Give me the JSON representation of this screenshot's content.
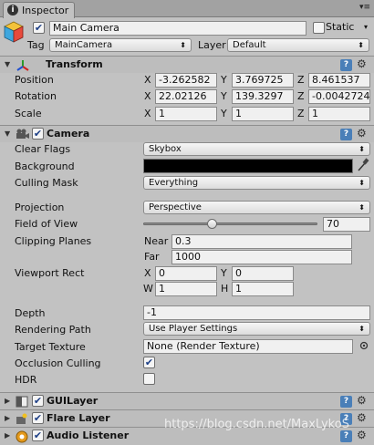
{
  "window": {
    "tab_label": "Inspector",
    "tab_icon": "info-icon",
    "menu_glyph": "▾≡"
  },
  "object": {
    "active": true,
    "name": "Main Camera",
    "static_label": "Static",
    "static_checked": false,
    "tag_label": "Tag",
    "tag_value": "MainCamera",
    "layer_label": "Layer",
    "layer_value": "Default"
  },
  "transform": {
    "title": "Transform",
    "position_label": "Position",
    "rotation_label": "Rotation",
    "scale_label": "Scale",
    "axes": {
      "x": "X",
      "y": "Y",
      "z": "Z"
    },
    "position": {
      "x": "-3.262582",
      "y": "3.769725",
      "z": "8.461537"
    },
    "rotation": {
      "x": "22.02126",
      "y": "139.3297",
      "z": "-0.0042724"
    },
    "scale": {
      "x": "1",
      "y": "1",
      "z": "1"
    }
  },
  "camera": {
    "title": "Camera",
    "enabled": true,
    "clear_flags_label": "Clear Flags",
    "clear_flags_value": "Skybox",
    "background_label": "Background",
    "background_color": "#000000",
    "culling_mask_label": "Culling Mask",
    "culling_mask_value": "Everything",
    "projection_label": "Projection",
    "projection_value": "Perspective",
    "fov_label": "Field of View",
    "fov_value": "70",
    "fov_fraction": 0.39,
    "clipping_label": "Clipping Planes",
    "near_label": "Near",
    "near_value": "0.3",
    "far_label": "Far",
    "far_value": "1000",
    "viewport_label": "Viewport Rect",
    "viewport": {
      "x_label": "X",
      "x": "0",
      "y_label": "Y",
      "y": "0",
      "w_label": "W",
      "w": "1",
      "h_label": "H",
      "h": "1"
    },
    "depth_label": "Depth",
    "depth_value": "-1",
    "rendering_path_label": "Rendering Path",
    "rendering_path_value": "Use Player Settings",
    "target_texture_label": "Target Texture",
    "target_texture_value": "None (Render Texture)",
    "occlusion_label": "Occlusion Culling",
    "occlusion_checked": true,
    "hdr_label": "HDR",
    "hdr_checked": false
  },
  "components": {
    "gui_layer": {
      "title": "GUILayer",
      "enabled": true
    },
    "flare_layer": {
      "title": "Flare Layer",
      "enabled": true
    },
    "audio_listener": {
      "title": "Audio Listener",
      "enabled": true
    }
  },
  "watermark": "https://blog.csdn.net/MaxLykoS",
  "colors": {
    "accent": "#4a7fb8",
    "panel": "#c2c2c2",
    "header": "#bdbdbd"
  }
}
